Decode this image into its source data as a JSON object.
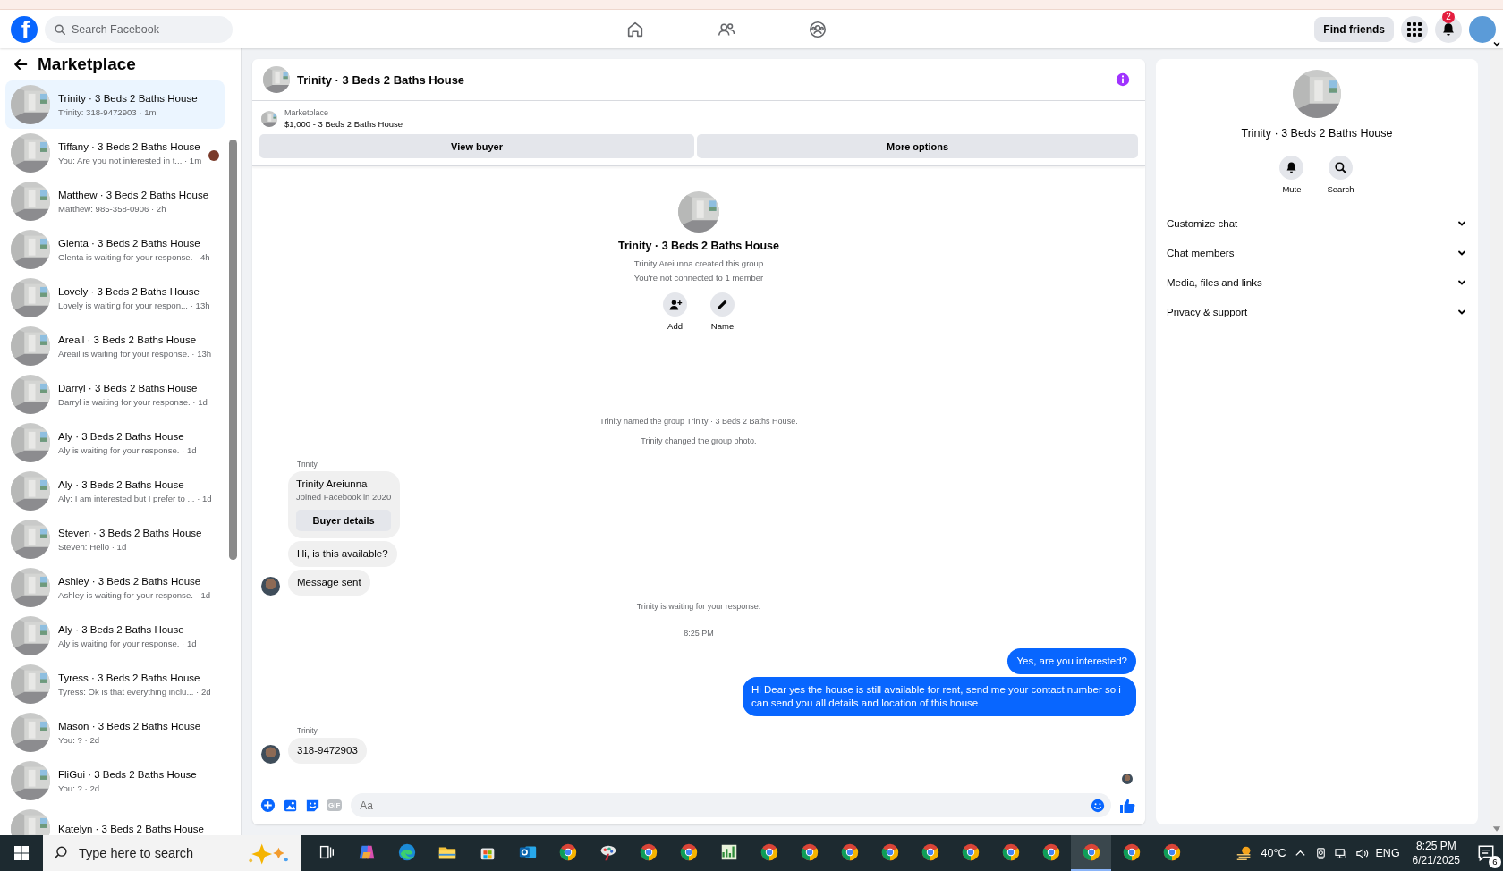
{
  "header": {
    "logo": "f",
    "search_placeholder": "Search Facebook",
    "find_friends": "Find friends",
    "notification_count": "2"
  },
  "sidebar": {
    "title": "Marketplace",
    "conversations": [
      {
        "title": "Trinity · 3 Beds 2 Baths House",
        "preview": "Trinity: 318-9472903 · 1m",
        "selected": true,
        "seen": false
      },
      {
        "title": "Tiffany · 3 Beds 2 Baths House",
        "preview": "You: Are you not interested in t... · 1m",
        "selected": false,
        "seen": true
      },
      {
        "title": "Matthew · 3 Beds 2 Baths House",
        "preview": "Matthew: 985-358-0906 · 2h",
        "selected": false,
        "seen": false
      },
      {
        "title": "Glenta · 3 Beds 2 Baths House",
        "preview": "Glenta is waiting for your response. · 4h",
        "selected": false,
        "seen": false
      },
      {
        "title": "Lovely · 3 Beds 2 Baths House",
        "preview": "Lovely is waiting for your respon... · 13h",
        "selected": false,
        "seen": false
      },
      {
        "title": "Areail · 3 Beds 2 Baths House",
        "preview": "Areail is waiting for your response. · 13h",
        "selected": false,
        "seen": false
      },
      {
        "title": "Darryl · 3 Beds 2 Baths House",
        "preview": "Darryl is waiting for your response. · 1d",
        "selected": false,
        "seen": false
      },
      {
        "title": "Aly · 3 Beds 2 Baths House",
        "preview": "Aly is waiting for your response. · 1d",
        "selected": false,
        "seen": false
      },
      {
        "title": "Aly · 3 Beds 2 Baths House",
        "preview": "Aly: I am interested but I prefer to ... · 1d",
        "selected": false,
        "seen": false
      },
      {
        "title": "Steven · 3 Beds 2 Baths House",
        "preview": "Steven: Hello · 1d",
        "selected": false,
        "seen": false
      },
      {
        "title": "Ashley · 3 Beds 2 Baths House",
        "preview": "Ashley is waiting for your response. · 1d",
        "selected": false,
        "seen": false
      },
      {
        "title": "Aly · 3 Beds 2 Baths House",
        "preview": "Aly is waiting for your response. · 1d",
        "selected": false,
        "seen": false
      },
      {
        "title": "Tyress · 3 Beds 2 Baths House",
        "preview": "Tyress: Ok is that everything inclu... · 2d",
        "selected": false,
        "seen": false
      },
      {
        "title": "Mason · 3 Beds 2 Baths House",
        "preview": "You: ? · 2d",
        "selected": false,
        "seen": false
      },
      {
        "title": "FliGui · 3 Beds 2 Baths House",
        "preview": "You: ? · 2d",
        "selected": false,
        "seen": false
      },
      {
        "title": "Katelyn · 3 Beds 2 Baths House",
        "selected": false,
        "seen": false
      }
    ]
  },
  "chat": {
    "title": "Trinity · 3 Beds 2 Baths House",
    "listing": {
      "source": "Marketplace",
      "item": "$1,000 - 3 Beds 2 Baths House"
    },
    "buttons": [
      "View buyer",
      "More options"
    ],
    "intro": {
      "title": "Trinity · 3 Beds 2 Baths House",
      "lines": [
        "Trinity Areiunna created this group",
        "You're not connected to 1 member"
      ],
      "actions": [
        {
          "kind": "add",
          "label": "Add"
        },
        {
          "kind": "name",
          "label": "Name"
        }
      ]
    },
    "messages": [
      {
        "kind": "system",
        "text": "Trinity named the group Trinity · 3 Beds 2 Baths House."
      },
      {
        "kind": "system",
        "text": "Trinity changed the group photo."
      },
      {
        "kind": "sender",
        "text": "Trinity"
      },
      {
        "kind": "profile_card",
        "name": "Trinity Areiunna",
        "info": "Joined Facebook in 2020",
        "button": "Buyer details"
      },
      {
        "kind": "incoming",
        "text": "Hi, is this available?",
        "avatar": false
      },
      {
        "kind": "incoming",
        "text": "Message sent",
        "avatar": true
      },
      {
        "kind": "system",
        "text": "Trinity is waiting for your response."
      },
      {
        "kind": "time",
        "text": "8:25 PM"
      },
      {
        "kind": "outgoing",
        "text": "Yes, are you interested?"
      },
      {
        "kind": "outgoing",
        "text": "Hi Dear yes the house is still available for rent, send me your contact number so i can send you all details and location of this house"
      },
      {
        "kind": "sender",
        "text": "Trinity"
      },
      {
        "kind": "incoming",
        "text": "318-9472903",
        "avatar": true
      },
      {
        "kind": "seen"
      }
    ],
    "composer": {
      "gif_label": "GIF",
      "placeholder": "Aa"
    }
  },
  "details": {
    "title": "Trinity · 3 Beds 2 Baths House",
    "actions": [
      {
        "kind": "mute",
        "label": "Mute"
      },
      {
        "kind": "search",
        "label": "Search"
      }
    ],
    "sections": [
      {
        "label": "Customize chat",
        "expanded": false
      },
      {
        "label": "Chat members",
        "expanded": false
      },
      {
        "label": "Media, files and links",
        "expanded": false
      },
      {
        "label": "Privacy & support",
        "expanded": false
      }
    ]
  },
  "taskbar": {
    "search_placeholder": "Type here to search",
    "apps": [
      {
        "kind": "taskview",
        "active": false
      },
      {
        "kind": "copilot",
        "active": false
      },
      {
        "kind": "edge",
        "active": false
      },
      {
        "kind": "folder",
        "active": false
      },
      {
        "kind": "store",
        "active": false
      },
      {
        "kind": "mail",
        "active": false
      },
      {
        "kind": "chrome",
        "active": false
      },
      {
        "kind": "paint",
        "active": false
      },
      {
        "kind": "chrome",
        "active": false
      },
      {
        "kind": "chrome",
        "active": false
      },
      {
        "kind": "chart",
        "active": false
      },
      {
        "kind": "chrome",
        "active": false
      },
      {
        "kind": "chrome",
        "active": false
      },
      {
        "kind": "chrome",
        "active": false
      },
      {
        "kind": "chrome",
        "active": false
      },
      {
        "kind": "chrome",
        "active": false
      },
      {
        "kind": "chrome",
        "active": false
      },
      {
        "kind": "chrome",
        "active": false
      },
      {
        "kind": "chrome",
        "active": false
      },
      {
        "kind": "chrome",
        "active": true
      },
      {
        "kind": "chrome",
        "active": false
      },
      {
        "kind": "chrome",
        "active": false
      }
    ],
    "weather": "40°C",
    "language": "ENG",
    "time": "8:25 PM",
    "date": "6/21/2025",
    "notifications": "6"
  }
}
